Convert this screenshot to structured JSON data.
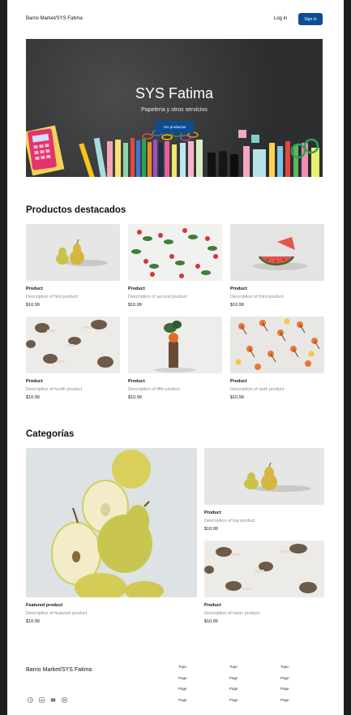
{
  "header": {
    "brand": "Barrio Market/SYS Fatima",
    "login_label": "Log in",
    "signin_label": "Sign in"
  },
  "hero": {
    "title": "SYS Fatima",
    "subtitle": "Papeleria y otros servicios",
    "cta_label": "Ver productos"
  },
  "featured": {
    "title": "Productos destacados",
    "products": [
      {
        "name": "Product",
        "desc": "Description of first product",
        "price": "$10.99",
        "image": "pears"
      },
      {
        "name": "Product",
        "desc": "Description of second product",
        "price": "$10.99",
        "image": "radishes"
      },
      {
        "name": "Product",
        "desc": "Description of third product",
        "price": "$10.99",
        "image": "watermelon"
      },
      {
        "name": "Product",
        "desc": "Description of fourth product",
        "price": "$10.99",
        "image": "mushrooms"
      },
      {
        "name": "Product",
        "desc": "Description of fifth product",
        "price": "$10.99",
        "image": "vegetable-stack"
      },
      {
        "name": "Product",
        "desc": "Description of sixth product",
        "price": "$10.99",
        "image": "cherries"
      }
    ]
  },
  "categories": {
    "title": "Categorías",
    "featured": {
      "name": "Featured product",
      "desc": "Description of featured product",
      "price": "$10.99"
    },
    "top": {
      "name": "Product",
      "desc": "Description of top product",
      "price": "$10.99"
    },
    "lower": {
      "name": "Product",
      "desc": "Description of lower product",
      "price": "$10.99"
    }
  },
  "footer": {
    "brand": "Barrio Market/SYS Fatima",
    "columns": [
      {
        "topic": "Topic",
        "pages": [
          "Page",
          "Page",
          "Page"
        ]
      },
      {
        "topic": "Topic",
        "pages": [
          "Page",
          "Page",
          "Page"
        ]
      },
      {
        "topic": "Topic",
        "pages": [
          "Page",
          "Page",
          "Page"
        ]
      }
    ],
    "social_icons": [
      "facebook-icon",
      "linkedin-icon",
      "youtube-icon",
      "instagram-icon"
    ]
  },
  "colors": {
    "accent": "#0b4d93",
    "hero_bg": "#3a3b3d"
  }
}
